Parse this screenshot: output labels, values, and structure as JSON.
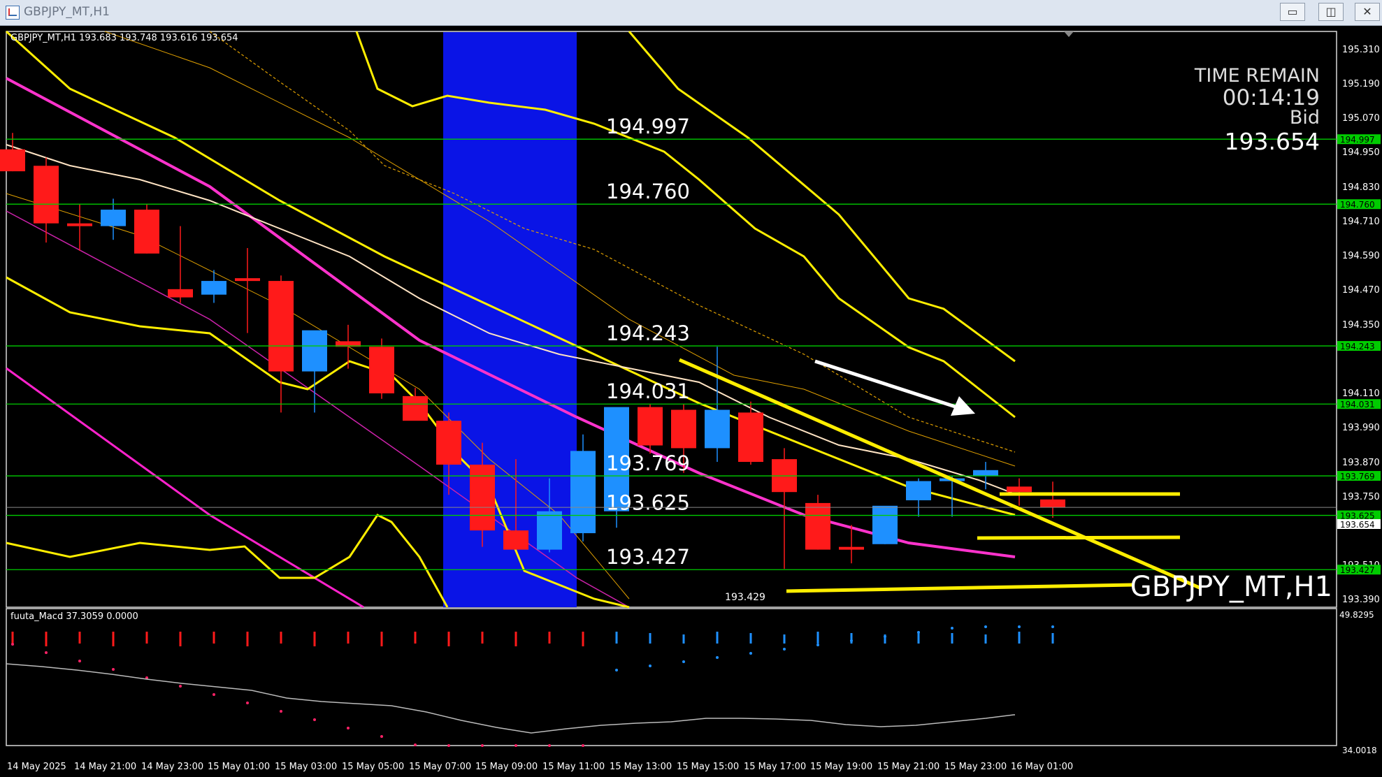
{
  "window": {
    "title": "GBPJPY_MT,H1",
    "minimize": "▭",
    "restore": "◫",
    "close": "✕"
  },
  "chart": {
    "info_line": "GBPJPY_MT,H1  193.683 193.748 193.616 193.654",
    "time_remain_label": "TIME REMAIN",
    "time_remain": "00:14:19",
    "bid_label": "Bid",
    "bid": "193.654",
    "symbol_watermark": "GBPJPY_MT,H1",
    "low_marker": "193.429",
    "price_axis": [
      "195.310",
      "195.190",
      "195.070",
      "194.950",
      "194.830",
      "194.710",
      "194.590",
      "194.470",
      "194.350",
      "194.110",
      "193.990",
      "193.870",
      "193.750",
      "193.510",
      "193.390"
    ],
    "current_price_tag": "193.654",
    "levels": [
      {
        "label": "194.997",
        "price": 194.997
      },
      {
        "label": "194.760",
        "price": 194.76
      },
      {
        "label": "194.243",
        "price": 194.243
      },
      {
        "label": "194.031",
        "price": 194.031
      },
      {
        "label": "193.769",
        "price": 193.769
      },
      {
        "label": "193.625",
        "price": 193.625
      },
      {
        "label": "193.427",
        "price": 193.427
      }
    ],
    "time_axis": [
      "14 May 2025",
      "14 May 21:00",
      "14 May 23:00",
      "15 May 01:00",
      "15 May 03:00",
      "15 May 05:00",
      "15 May 07:00",
      "15 May 09:00",
      "15 May 11:00",
      "15 May 13:00",
      "15 May 15:00",
      "15 May 17:00",
      "15 May 19:00",
      "15 May 21:00",
      "15 May 23:00",
      "16 May 01:00"
    ]
  },
  "macd": {
    "label": "fuuta_Macd 37.3059   0.0000",
    "axis_top": "49.8295",
    "axis_bottom": "34.0018"
  },
  "chart_data": {
    "type": "candlestick",
    "candles": [
      {
        "o": 194.96,
        "h": 195.02,
        "l": 194.88,
        "c": 194.88
      },
      {
        "o": 194.9,
        "h": 194.93,
        "l": 194.62,
        "c": 194.69
      },
      {
        "o": 194.69,
        "h": 194.76,
        "l": 194.59,
        "c": 194.68
      },
      {
        "o": 194.68,
        "h": 194.78,
        "l": 194.63,
        "c": 194.74
      },
      {
        "o": 194.74,
        "h": 194.76,
        "l": 194.58,
        "c": 194.58
      },
      {
        "o": 194.45,
        "h": 194.68,
        "l": 194.4,
        "c": 194.42
      },
      {
        "o": 194.43,
        "h": 194.52,
        "l": 194.4,
        "c": 194.48
      },
      {
        "o": 194.49,
        "h": 194.6,
        "l": 194.29,
        "c": 194.48
      },
      {
        "o": 194.48,
        "h": 194.5,
        "l": 194.0,
        "c": 194.15
      },
      {
        "o": 194.15,
        "h": 194.22,
        "l": 194.0,
        "c": 194.3
      },
      {
        "o": 194.26,
        "h": 194.32,
        "l": 194.16,
        "c": 194.24
      },
      {
        "o": 194.24,
        "h": 194.27,
        "l": 194.05,
        "c": 194.07
      },
      {
        "o": 194.06,
        "h": 194.09,
        "l": 193.98,
        "c": 193.97
      },
      {
        "o": 193.97,
        "h": 194.0,
        "l": 193.7,
        "c": 193.81
      },
      {
        "o": 193.81,
        "h": 193.89,
        "l": 193.51,
        "c": 193.57
      },
      {
        "o": 193.57,
        "h": 193.83,
        "l": 193.51,
        "c": 193.5
      },
      {
        "o": 193.5,
        "h": 193.76,
        "l": 193.49,
        "c": 193.64
      },
      {
        "o": 193.56,
        "h": 193.92,
        "l": 193.53,
        "c": 193.86
      },
      {
        "o": 193.64,
        "h": 194.0,
        "l": 193.58,
        "c": 194.02
      },
      {
        "o": 194.02,
        "h": 194.03,
        "l": 193.85,
        "c": 193.88
      },
      {
        "o": 194.01,
        "h": 194.03,
        "l": 193.78,
        "c": 193.87
      },
      {
        "o": 193.87,
        "h": 194.24,
        "l": 193.82,
        "c": 194.01
      },
      {
        "o": 194.0,
        "h": 194.04,
        "l": 193.81,
        "c": 193.82
      },
      {
        "o": 193.83,
        "h": 193.87,
        "l": 193.43,
        "c": 193.71
      },
      {
        "o": 193.67,
        "h": 193.7,
        "l": 193.5,
        "c": 193.5
      },
      {
        "o": 193.51,
        "h": 193.59,
        "l": 193.45,
        "c": 193.5
      },
      {
        "o": 193.52,
        "h": 193.65,
        "l": 193.52,
        "c": 193.66
      },
      {
        "o": 193.68,
        "h": 193.76,
        "l": 193.62,
        "c": 193.75
      },
      {
        "o": 193.75,
        "h": 193.77,
        "l": 193.62,
        "c": 193.76
      },
      {
        "o": 193.77,
        "h": 193.82,
        "l": 193.72,
        "c": 193.79
      },
      {
        "o": 193.73,
        "h": 193.76,
        "l": 193.66,
        "c": 193.71
      },
      {
        "o": 193.683,
        "h": 193.748,
        "l": 193.616,
        "c": 193.654
      }
    ]
  }
}
